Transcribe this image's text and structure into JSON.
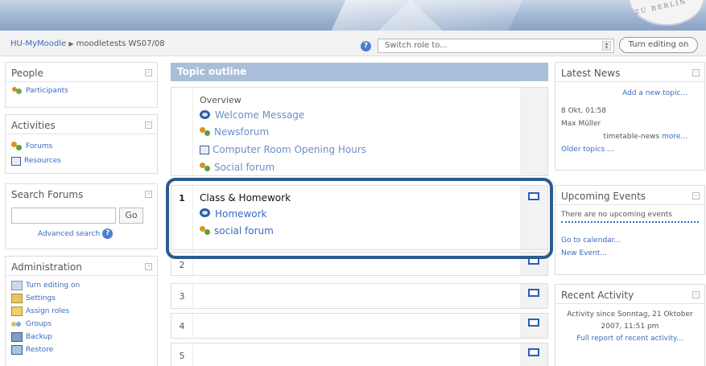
{
  "banner": {
    "seal_text": "ZU BERLIN"
  },
  "nav": {
    "breadcrumb_home": "HU-MyMoodle",
    "breadcrumb_sep": "▶",
    "breadcrumb_course": "moodletests WS07/08",
    "help_icon": "?",
    "role_placeholder": "Switch role to...",
    "edit_button": "Turn editing on"
  },
  "left": {
    "people": {
      "title": "People",
      "items": [
        "Participants"
      ]
    },
    "activities": {
      "title": "Activities",
      "items": [
        "Forums",
        "Resources"
      ]
    },
    "search": {
      "title": "Search Forums",
      "go": "Go",
      "advanced": "Advanced search"
    },
    "admin": {
      "title": "Administration",
      "items": [
        "Turn editing on",
        "Settings",
        "Assign roles",
        "Groups",
        "Backup",
        "Restore"
      ]
    }
  },
  "main": {
    "title": "Topic outline",
    "overview": {
      "title": "Overview",
      "items": [
        "Welcome Message",
        "Newsforum",
        "Computer Room Opening Hours",
        "Social forum"
      ]
    },
    "section1": {
      "number": "1",
      "title": "Class & Homework",
      "items": [
        "Homework",
        "social forum"
      ]
    },
    "sections": [
      "2",
      "3",
      "4",
      "5"
    ]
  },
  "right": {
    "news": {
      "title": "Latest News",
      "add": "Add a new topic...",
      "date": "8 Okt, 01:58",
      "author": "Max Müller",
      "subject": "timetable-news",
      "more": "more...",
      "older": "Older topics ..."
    },
    "events": {
      "title": "Upcoming Events",
      "none": "There are no upcoming events",
      "calendar": "Go to calendar...",
      "new_event": "New Event..."
    },
    "activity": {
      "title": "Recent Activity",
      "since": "Activity since Sonntag, 21 Oktober 2007, 11:51 pm",
      "report": "Full report of recent activity..."
    }
  },
  "colors": {
    "accent": "#a9bfd9",
    "link": "#3a6bbf",
    "highlight": "#2d5a8e"
  }
}
